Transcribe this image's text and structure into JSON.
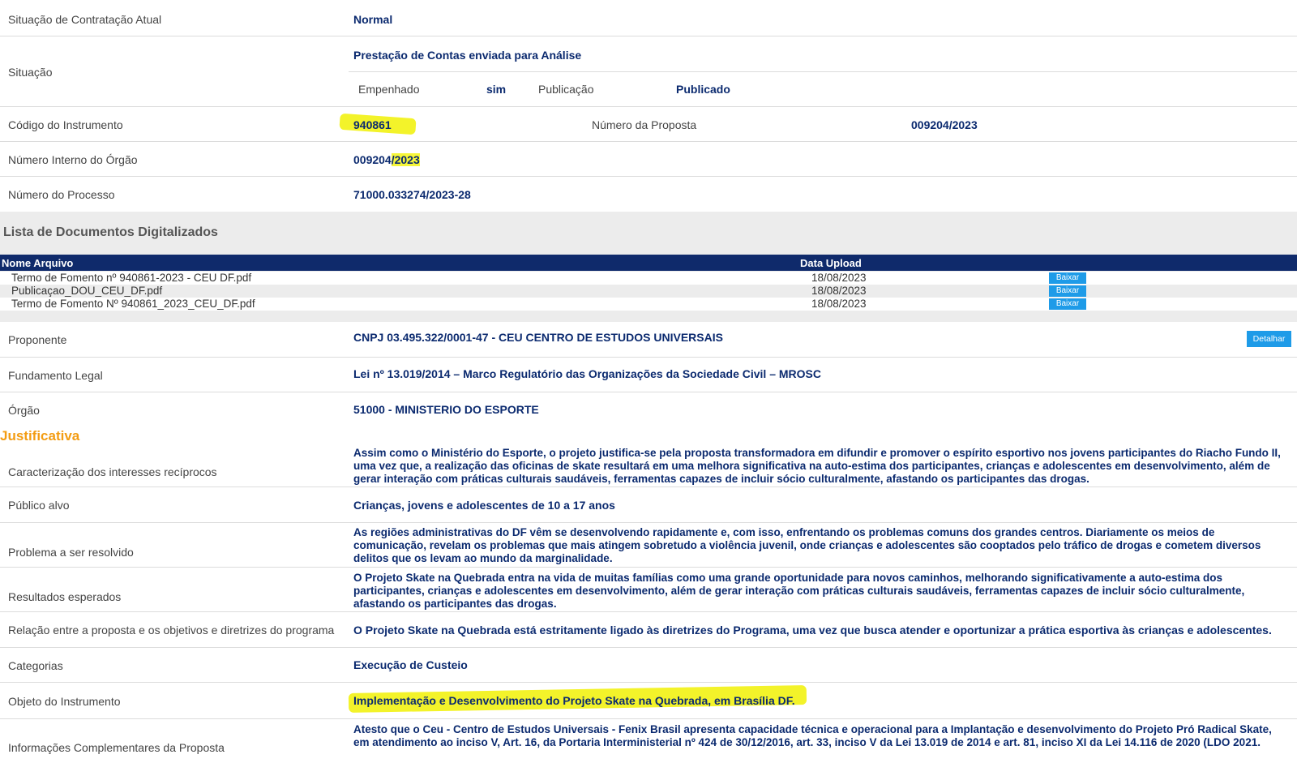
{
  "contract": {
    "situacao_contratacao": {
      "label": "Situação de Contratação Atual",
      "value": "Normal"
    },
    "situacao": {
      "label": "Situação",
      "value": "Prestação de Contas enviada para Análise"
    },
    "empenhado": {
      "label": "Empenhado",
      "value": "sim"
    },
    "publicacao": {
      "label": "Publicação",
      "value": "Publicado"
    },
    "codigo_instrumento": {
      "label": "Código do Instrumento",
      "value": "940861"
    },
    "numero_proposta": {
      "label": "Número da Proposta",
      "value": "009204/2023"
    },
    "numero_interno": {
      "label": "Número Interno do Órgão",
      "value_a": "009204",
      "value_b": "/2023"
    },
    "numero_processo": {
      "label": "Número do Processo",
      "value": "71000.033274/2023-28"
    }
  },
  "documents": {
    "title": "Lista de Documentos Digitalizados",
    "col_nome": "Nome Arquivo",
    "col_data": "Data Upload",
    "rows": [
      {
        "nome": "Termo de Fomento nº 940861-2023 - CEU DF.pdf",
        "data": "18/08/2023",
        "action": "Baixar"
      },
      {
        "nome": "Publicaçao_DOU_CEU_DF.pdf",
        "data": "18/08/2023",
        "action": "Baixar"
      },
      {
        "nome": "Termo de Fomento Nº 940861_2023_CEU_DF.pdf",
        "data": "18/08/2023",
        "action": "Baixar"
      }
    ]
  },
  "details": {
    "proponente": {
      "label": "Proponente",
      "value": "CNPJ 03.495.322/0001-47 - CEU CENTRO DE ESTUDOS UNIVERSAIS",
      "action": "Detalhar"
    },
    "fundamento": {
      "label": "Fundamento Legal",
      "value": "Lei nº 13.019/2014 – Marco Regulatório das Organizações da Sociedade Civil – MROSC"
    },
    "orgao": {
      "label": "Órgão",
      "value": "51000 - MINISTERIO DO ESPORTE"
    }
  },
  "justificativa": {
    "title": "Justificativa",
    "interesses": {
      "label": "Caracterização dos interesses recíprocos",
      "value": "Assim como o Ministério do Esporte, o projeto justifica-se pela proposta transformadora em difundir e promover o espírito esportivo nos jovens participantes do Riacho Fundo II, uma vez que, a realização das oficinas de skate resultará em uma melhora significativa na auto-estima dos participantes, crianças e adolescentes em desenvolvimento, além de gerar interação com práticas culturais saudáveis, ferramentas capazes de incluir sócio culturalmente, afastando os participantes das drogas."
    },
    "publico": {
      "label": "Público alvo",
      "value": "Crianças, jovens e adolescentes de 10 a 17 anos"
    },
    "problema": {
      "label": "Problema a ser resolvido",
      "value": "As regiões administrativas do DF vêm se desenvolvendo rapidamente e, com isso, enfrentando os problemas comuns dos grandes centros. Diariamente os meios de comunicação, revelam os problemas que mais atingem sobretudo a violência juvenil, onde crianças e adolescentes são cooptados pelo tráfico de drogas e cometem diversos delitos que os levam ao mundo da marginalidade."
    },
    "resultados": {
      "label": "Resultados esperados",
      "value": "O Projeto Skate na Quebrada entra na vida de muitas famílias como uma grande oportunidade para novos caminhos, melhorando significativamente a auto-estima dos participantes, crianças e adolescentes em desenvolvimento, além de gerar interação com práticas culturais saudáveis, ferramentas capazes de incluir sócio culturalmente, afastando os participantes das drogas."
    },
    "relacao": {
      "label": "Relação entre a proposta e os objetivos e diretrizes do programa",
      "value": "O Projeto Skate na Quebrada está estritamente ligado às diretrizes do Programa, uma vez que busca atender e oportunizar a prática esportiva às crianças e adolescentes."
    },
    "categorias": {
      "label": "Categorias",
      "value": "Execução de Custeio"
    },
    "objeto": {
      "label": "Objeto do Instrumento",
      "value": "Implementação e Desenvolvimento do Projeto Skate na Quebrada, em Brasília DF."
    },
    "informacoes": {
      "label": "Informações Complementares da Proposta",
      "value": "Atesto que o Ceu - Centro de Estudos Universais - Fenix Brasil apresenta capacidade técnica e operacional para a Implantação e desenvolvimento do Projeto Pró Radical Skate, em atendimento ao inciso V, Art. 16, da Portaria Interministerial nº 424 de 30/12/2016, art. 33, inciso V da Lei 13.019 de 2014 e art. 81, inciso XI da Lei 14.116 de 2020 (LDO 2021."
    }
  },
  "colors": {
    "label": "#444444",
    "value": "#0b2a6f",
    "header_bg": "#0f2a6b",
    "button": "#1e9be8",
    "highlight": "#f6f63a",
    "section_title": "#f39c12"
  }
}
